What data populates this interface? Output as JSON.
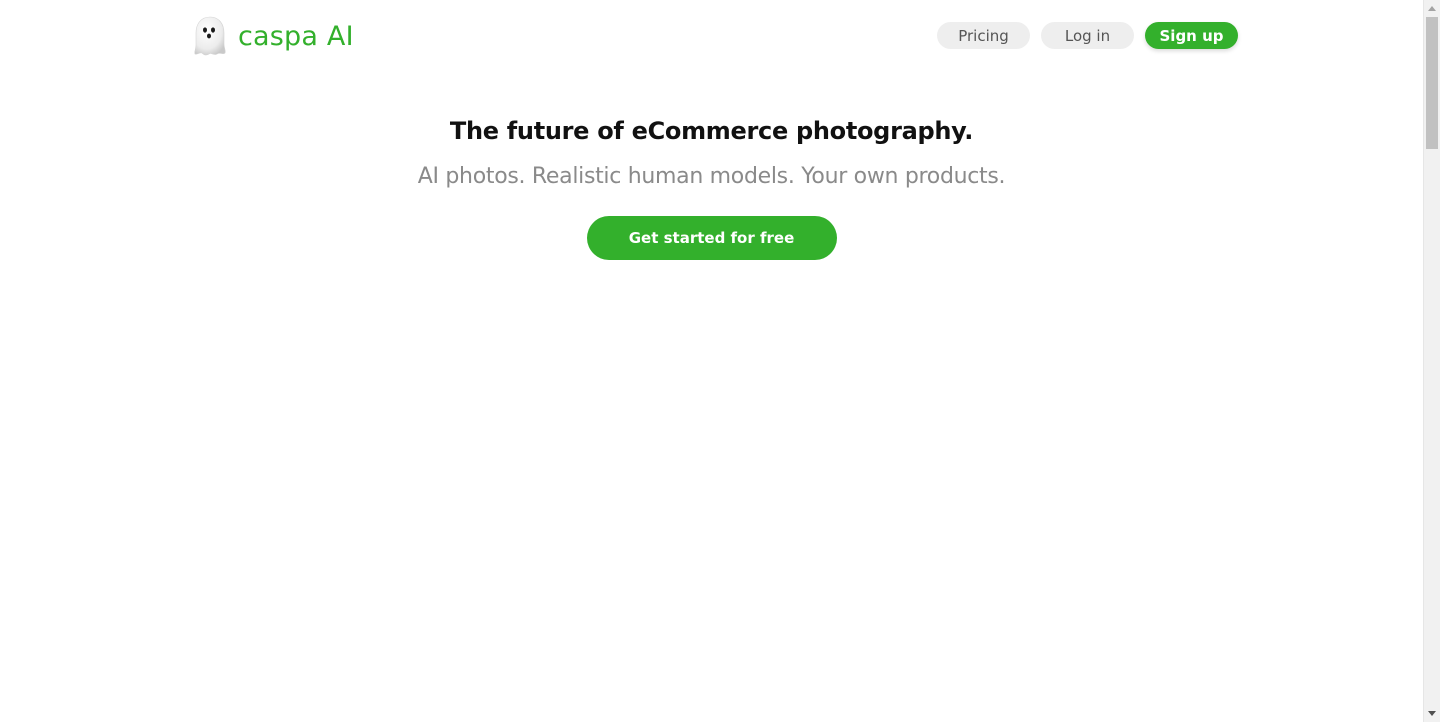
{
  "brand": {
    "name": "caspa AI",
    "color": "#33b02c",
    "icon": "ghost-icon"
  },
  "nav": {
    "pricing_label": "Pricing",
    "login_label": "Log in",
    "signup_label": "Sign up"
  },
  "hero": {
    "title": "The future of eCommerce photography.",
    "subtitle": "AI photos. Realistic human models. Your own products.",
    "cta_label": "Get started for free"
  },
  "colors": {
    "accent": "#33b02c",
    "nav_button_bg": "#eeeeee",
    "subtitle_text": "#8a8a8a"
  }
}
